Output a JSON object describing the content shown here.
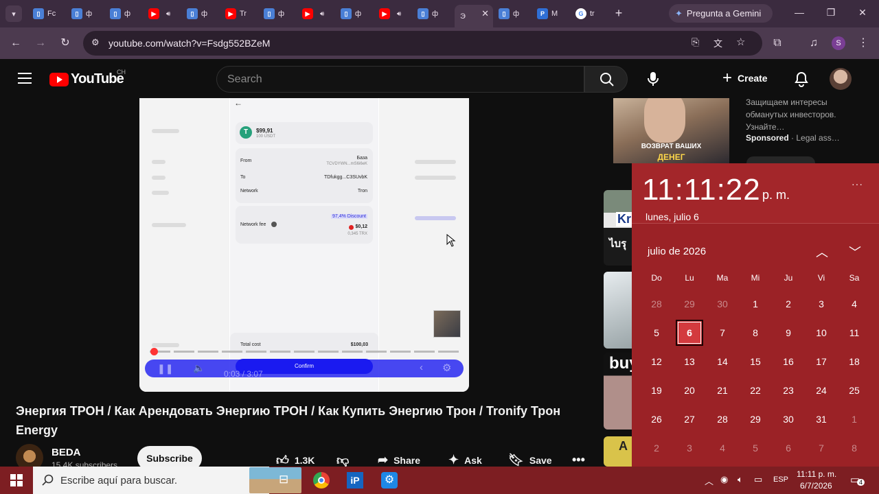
{
  "browser": {
    "tabs": [
      {
        "label": "Fc",
        "type": "doc"
      },
      {
        "label": "ф",
        "type": "doc"
      },
      {
        "label": "ф",
        "type": "doc"
      },
      {
        "label": "",
        "type": "yt"
      },
      {
        "label": "ф",
        "type": "doc"
      },
      {
        "label": "Tr",
        "type": "yt"
      },
      {
        "label": "ф",
        "type": "doc"
      },
      {
        "label": "",
        "type": "yt"
      },
      {
        "label": "ф",
        "type": "doc"
      },
      {
        "label": "",
        "type": "yt"
      },
      {
        "label": "ф",
        "type": "doc"
      },
      {
        "label": "Э",
        "type": "active"
      },
      {
        "label": "ф",
        "type": "doc"
      },
      {
        "label": "M",
        "type": "p"
      },
      {
        "label": "tr",
        "type": "g"
      }
    ],
    "gemini_label": "Pregunta a Gemini",
    "url": "youtube.com/watch?v=Fsdg552BZeM",
    "profile_initial": "S"
  },
  "youtube": {
    "logo_text": "YouTube",
    "country": "CH",
    "search_placeholder": "Search",
    "create_label": "Create"
  },
  "player": {
    "amount": "$99,91",
    "amount_sub": "100 USDT",
    "from_label": "From",
    "from_name": "База",
    "from_addr": "TCVDYWN...mS6i6eK",
    "to_label": "To",
    "to_addr": "TDfukgg...C3SUvbK",
    "network_label": "Network",
    "network_value": "Tron",
    "fee_label": "Network fee",
    "discount": "97,4% Discount",
    "fee_usd": "$0,12",
    "fee_trx": "0,345 TRX",
    "total_label": "Total cost",
    "total_value": "$100,03",
    "confirm_label": "Confirm",
    "time": "0:03 / 3:07",
    "progress_fraction": 0.016
  },
  "video": {
    "title": "Энергия ТРОН / Как Арендовать Энергию ТРОН / Как Купить Энергию Трон / Tronify Трон Energy",
    "channel": "BEDA",
    "subscribers": "15.4K subscribers",
    "subscribe_label": "Subscribe",
    "likes": "1.3K",
    "share_label": "Share",
    "ask_label": "Ask",
    "save_label": "Save"
  },
  "sidebar": {
    "ad_line1": "ВОЗВРАТ ВАШИХ",
    "ad_line2": "ДЕНЕГ",
    "ad_text": "Защищаем интересы обманутых инвесторов. Узнайте…",
    "sponsored": "Sponsored",
    "advertiser": "· Legal ass…",
    "thumb2_text": "Kr",
    "thumb2_sub": "ไบรุ",
    "thumb4_text": "buy",
    "thumb5_text": "A"
  },
  "calendar": {
    "time": "11:11:22",
    "ampm": "p. m.",
    "date_long": "lunes, julio 6",
    "month_label": "julio de 2026",
    "weekdays": [
      "Do",
      "Lu",
      "Ma",
      "Mi",
      "Ju",
      "Vi",
      "Sa"
    ],
    "days": [
      [
        "28",
        "29",
        "30",
        "1",
        "2",
        "3",
        "4"
      ],
      [
        "5",
        "6",
        "7",
        "8",
        "9",
        "10",
        "11"
      ],
      [
        "12",
        "13",
        "14",
        "15",
        "16",
        "17",
        "18"
      ],
      [
        "19",
        "20",
        "21",
        "22",
        "23",
        "24",
        "25"
      ],
      [
        "26",
        "27",
        "28",
        "29",
        "30",
        "31",
        "1"
      ],
      [
        "2",
        "3",
        "4",
        "5",
        "6",
        "7",
        "8"
      ]
    ],
    "today": "6",
    "accent": "#9b2226"
  },
  "taskbar": {
    "search_placeholder": "Escribe aquí para buscar.",
    "language": "ESP",
    "clock_time": "11:11 p. m.",
    "clock_date": "6/7/2026",
    "notification_count": "4"
  }
}
